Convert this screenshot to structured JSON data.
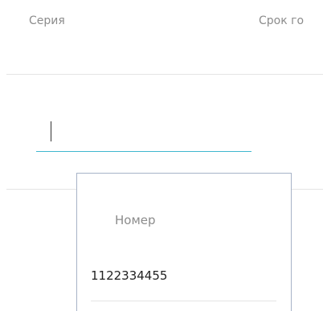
{
  "table": {
    "columns": [
      "Серия",
      "Срок го"
    ]
  },
  "input": {
    "value": ""
  },
  "dropdown": {
    "header": "Номер",
    "options": [
      "1122334455"
    ]
  }
}
